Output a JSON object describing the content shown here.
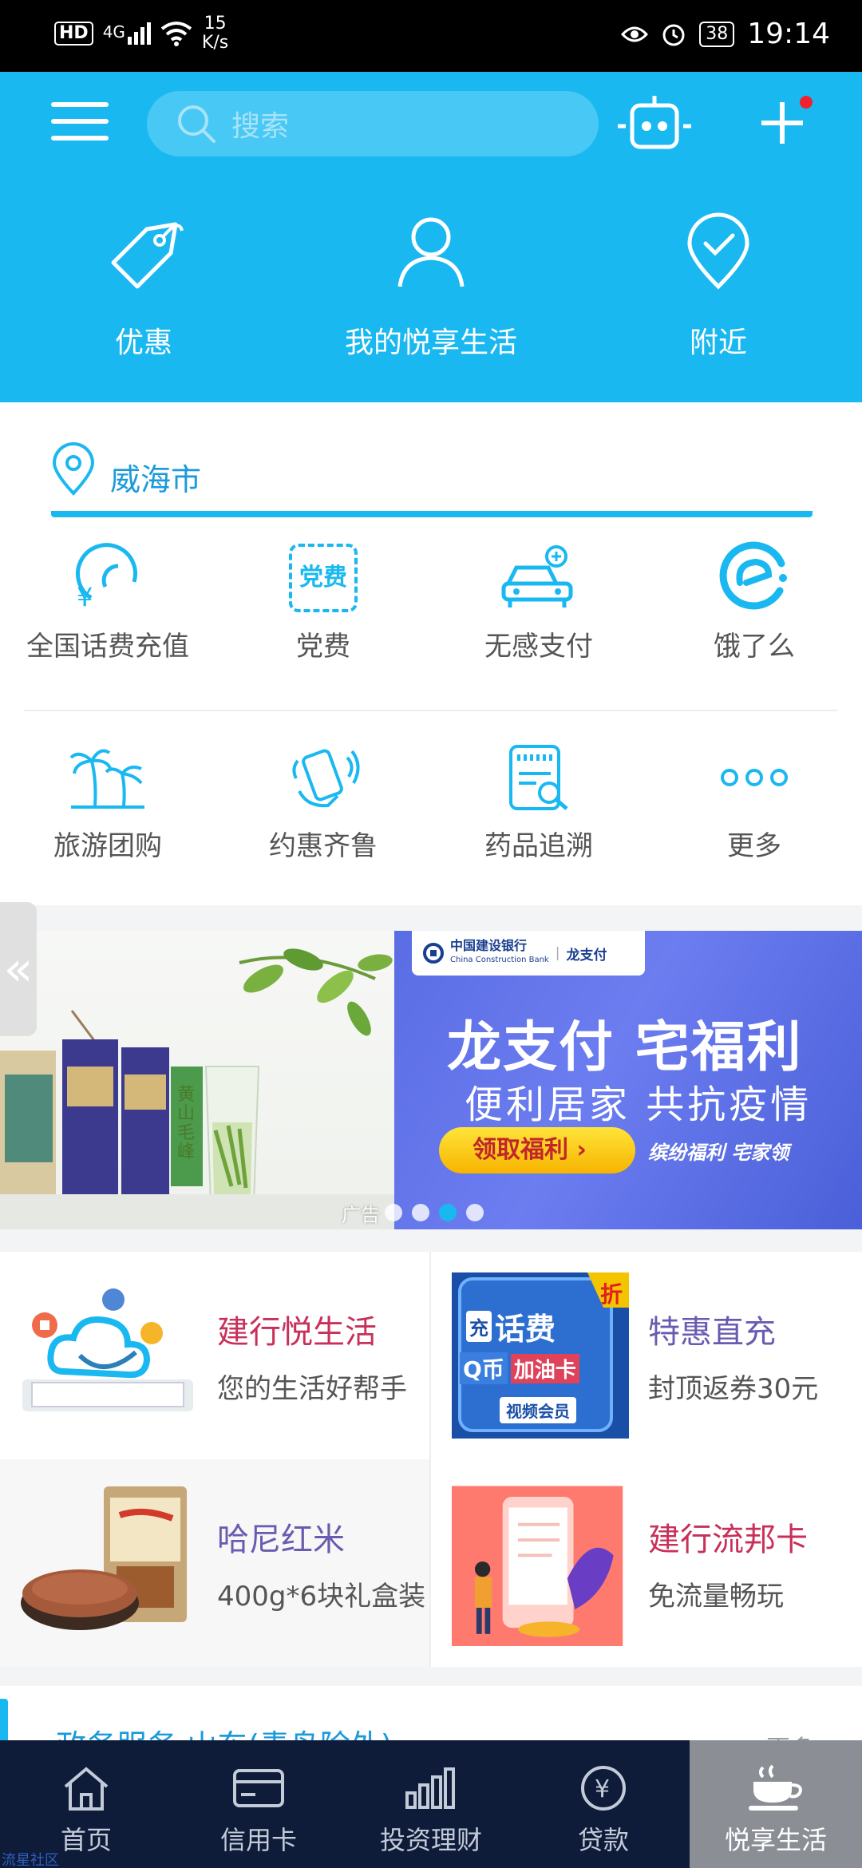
{
  "status_bar": {
    "hd": "HD",
    "signal": "4G",
    "speed_value": "15",
    "speed_unit": "K/s",
    "battery": "38",
    "time": "19:14"
  },
  "header": {
    "search_placeholder": "搜索",
    "top_categories": [
      {
        "label": "优惠",
        "icon": "tag-icon"
      },
      {
        "label": "我的悦享生活",
        "icon": "user-icon"
      },
      {
        "label": "附近",
        "icon": "location-check-icon"
      }
    ]
  },
  "location": {
    "city": "威海市"
  },
  "services": [
    {
      "label": "全国话费充值",
      "icon": "phone-recharge-icon"
    },
    {
      "label": "党费",
      "icon": "party-fee-icon",
      "icon_text": "党费"
    },
    {
      "label": "无感支付",
      "icon": "car-pay-icon"
    },
    {
      "label": "饿了么",
      "icon": "eleme-icon"
    },
    {
      "label": "旅游团购",
      "icon": "palm-tree-icon"
    },
    {
      "label": "约惠齐鲁",
      "icon": "hand-phone-icon"
    },
    {
      "label": "药品追溯",
      "icon": "medicine-trace-icon"
    },
    {
      "label": "更多",
      "icon": "more-icon"
    }
  ],
  "banner": {
    "bank_name_cn": "中国建设银行",
    "bank_name_en": "China Construction Bank",
    "pay_brand": "龙支付",
    "headline": "龙支付 宅福利",
    "subline": "便利居家 共抗疫情",
    "button": "领取福利 ›",
    "tagline": "缤纷福利 宅家领",
    "tea_label": "黄山毛峰",
    "ad_tag": "广告",
    "dots_total": 4,
    "active_dot": 3
  },
  "cards": [
    {
      "title": "建行悦生活",
      "subtitle": "您的生活好帮手",
      "title_color": "#c8305a",
      "image": "cloud-tablet-illustration"
    },
    {
      "title": "特惠直充",
      "subtitle": "封顶返券30元",
      "title_color": "#6a5bb0",
      "image": "recharge-poster",
      "poster_texts": [
        "话费",
        "Q币",
        "加油卡",
        "视频会员",
        "折",
        "充"
      ]
    },
    {
      "title": "哈尼红米",
      "subtitle": "400g*6块礼盒装",
      "title_color": "#6a5bb0",
      "image": "red-rice-bag"
    },
    {
      "title": "建行流邦卡",
      "subtitle": "免流量畅玩",
      "title_color": "#c8305a",
      "image": "phone-illustration"
    }
  ],
  "gov_services": {
    "title": "政务服务 山东(青岛除外)",
    "more": "更多"
  },
  "tabbar": [
    {
      "label": "首页",
      "icon": "home-icon",
      "active": false
    },
    {
      "label": "信用卡",
      "icon": "credit-card-icon",
      "active": false
    },
    {
      "label": "投资理财",
      "icon": "bar-chart-icon",
      "active": false
    },
    {
      "label": "贷款",
      "icon": "yuan-coin-icon",
      "active": false
    },
    {
      "label": "悦享生活",
      "icon": "coffee-cup-icon",
      "active": true
    }
  ],
  "watermark": "流星社区",
  "colors": {
    "primary": "#1ab8f1",
    "nav_bg": "#0e1c3a",
    "badge": "#f0222d"
  }
}
